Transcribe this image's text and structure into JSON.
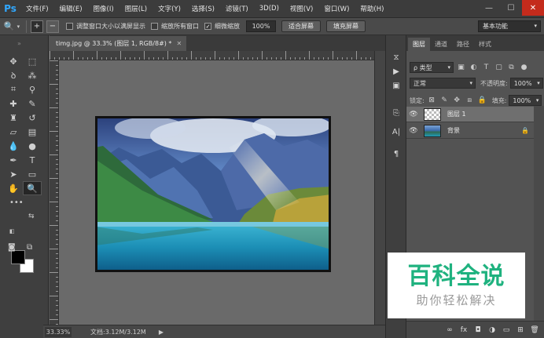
{
  "app": {
    "logo": "Ps"
  },
  "menu": [
    "文件(F)",
    "编辑(E)",
    "图像(I)",
    "图层(L)",
    "文字(Y)",
    "选择(S)",
    "滤镜(T)",
    "3D(D)",
    "视图(V)",
    "窗口(W)",
    "帮助(H)"
  ],
  "window_controls": {
    "minimize": "—",
    "maximize": "☐",
    "close": "✕"
  },
  "options": {
    "tool_icon": "zoom-icon",
    "resize_windows": "调整窗口大小以满屏显示",
    "resize_windows_checked": false,
    "zoom_all_windows": "缩放所有窗口",
    "zoom_all_windows_checked": false,
    "scrubby_zoom": "细微缩放",
    "scrubby_zoom_checked": true,
    "zoom_value": "100%",
    "fit_screen": "适合屏幕",
    "fill_screen": "填充屏幕",
    "workspace": "基本功能"
  },
  "document": {
    "tab_title": "timg.jpg @ 33.3% (图层 1, RGB/8#) *",
    "tab_close": "✕",
    "zoom": "33.33%",
    "doc_info": "文档:3.12M/3.12M",
    "status_arrow": "▶"
  },
  "tools": [
    {
      "name": "move-tool",
      "glyph": "✥"
    },
    {
      "name": "marquee-tool",
      "glyph": "⬚"
    },
    {
      "name": "lasso-tool",
      "glyph": "ꝺ"
    },
    {
      "name": "magic-wand-tool",
      "glyph": "⁂"
    },
    {
      "name": "crop-tool",
      "glyph": "⌗"
    },
    {
      "name": "eyedropper-tool",
      "glyph": "⚲"
    },
    {
      "name": "healing-brush-tool",
      "glyph": "✚"
    },
    {
      "name": "brush-tool",
      "glyph": "✎"
    },
    {
      "name": "clone-stamp-tool",
      "glyph": "♜"
    },
    {
      "name": "history-brush-tool",
      "glyph": "↺"
    },
    {
      "name": "eraser-tool",
      "glyph": "▱"
    },
    {
      "name": "gradient-tool",
      "glyph": "▤"
    },
    {
      "name": "blur-tool",
      "glyph": "💧"
    },
    {
      "name": "dodge-tool",
      "glyph": "●"
    },
    {
      "name": "pen-tool",
      "glyph": "✒"
    },
    {
      "name": "type-tool",
      "glyph": "T"
    },
    {
      "name": "path-selection-tool",
      "glyph": "➤"
    },
    {
      "name": "shape-tool",
      "glyph": "▭"
    },
    {
      "name": "hand-tool",
      "glyph": "✋"
    },
    {
      "name": "zoom-tool",
      "glyph": "🔍"
    }
  ],
  "layers_panel": {
    "tabs": [
      "图层",
      "通道",
      "路径",
      "样式"
    ],
    "filter_kind": "ρ 类型",
    "blend_mode": "正常",
    "opacity_label": "不透明度:",
    "opacity_value": "100%",
    "lock_label": "锁定:",
    "fill_label": "填充:",
    "fill_value": "100%",
    "layers": [
      {
        "name": "图层 1",
        "selected": true,
        "locked": false
      },
      {
        "name": "背景",
        "selected": false,
        "locked": true
      }
    ]
  },
  "watermark": {
    "title": "百科全说",
    "subtitle": "助你轻松解决"
  }
}
